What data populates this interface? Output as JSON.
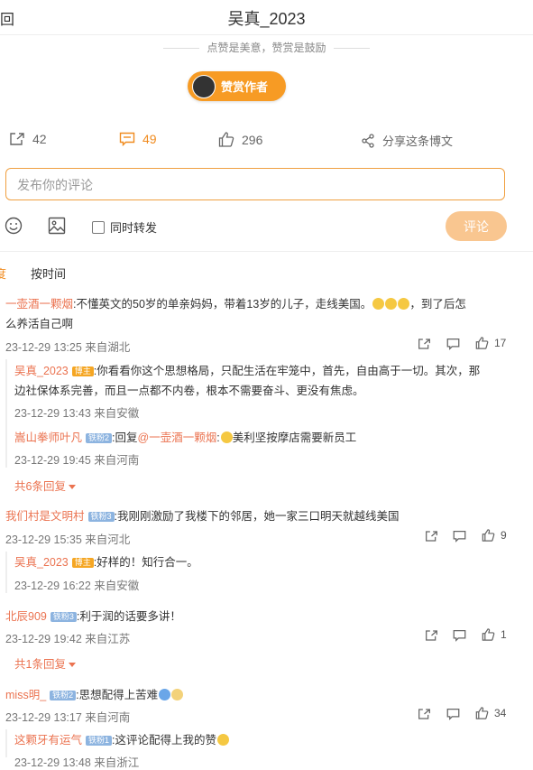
{
  "header": {
    "back_label": "回",
    "title": "吴真_2023"
  },
  "slogan": "点赞是美意，赞赏是鼓励",
  "reward_button": "赞赏作者",
  "actions": {
    "repost_count": "42",
    "comment_count": "49",
    "like_count": "296",
    "share_label": "分享这条博文"
  },
  "comment_input": {
    "placeholder": "发布你的评论"
  },
  "toolbar": {
    "also_repost_label": "同时转发",
    "submit_label": "评论"
  },
  "sort": {
    "hot_label": "度",
    "time_label": "按时间"
  },
  "comments": [
    {
      "user": "一壶酒一颗烟",
      "text_line1": ":不懂英文的50岁的单亲妈妈，带着13岁的儿子，走线美国。",
      "text_line1_tail": "，到了后怎",
      "text_line2": "么养活自己啊",
      "meta": "23-12-29 13:25 来自湖北",
      "likes": "17",
      "replies": [
        {
          "user": "吴真_2023",
          "badge": "博主",
          "text_line1": ":你看看你这个思想格局，只配生活在牢笼中，首先，自由高于一切。其次，那",
          "text_line2": "边社保体系完善，而且一点都不内卷，根本不需要奋斗、更没有焦虑。",
          "meta": "23-12-29 13:43 来自安徽"
        },
        {
          "user": "嵩山拳师叶凡",
          "badge": "铁粉2",
          "text_prefix": ":回复",
          "mention": "@一壶酒一颗烟",
          "text": ":",
          "text_tail": "美利坚按摩店需要新员工",
          "meta": "23-12-29 19:45 来自河南"
        }
      ],
      "more": "共6条回复"
    },
    {
      "user": "我们村是文明村",
      "badge": "铁粉3",
      "text": ":我刚刚激励了我楼下的邻居，她一家三口明天就越线美国",
      "meta": "23-12-29 15:35 来自河北",
      "likes": "9",
      "replies": [
        {
          "user": "吴真_2023",
          "badge": "博主",
          "text": ":好样的！知行合一。",
          "meta": "23-12-29 16:22 来自安徽"
        }
      ]
    },
    {
      "user": "北辰909",
      "badge": "铁粉3",
      "text": ":利于润的话要多讲！",
      "meta": "23-12-29 19:42 来自江苏",
      "likes": "1",
      "more": "共1条回复"
    },
    {
      "user": "miss明_",
      "badge": "铁粉2",
      "text": ":思想配得上苦难",
      "meta": "23-12-29 13:17 来自河南",
      "likes": "34",
      "replies": [
        {
          "user": "这颗牙有运气",
          "badge": "铁粉1",
          "text": ":这评论配得上我的赞",
          "meta": "23-12-29 13:48 来自浙江"
        }
      ]
    }
  ],
  "colors": {
    "accent": "#f08b1f",
    "username": "#eb7350",
    "submit_disabled": "#f9c690"
  }
}
